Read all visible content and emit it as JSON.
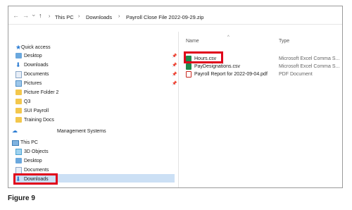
{
  "address_bar": {
    "back": "←",
    "forward": "→",
    "recent": "⌄",
    "up": "↑",
    "crumbs": [
      "This PC",
      "Downloads",
      "Payroll Close File 2022-09-29.zip"
    ]
  },
  "sidebar": {
    "quick_access": "Quick access",
    "items": [
      {
        "label": "Desktop"
      },
      {
        "label": "Downloads"
      },
      {
        "label": "Documents"
      },
      {
        "label": "Pictures"
      },
      {
        "label": "Picture Folder 2"
      },
      {
        "label": "Q3"
      },
      {
        "label": "SUI Payroll"
      },
      {
        "label": "Training Docs"
      }
    ],
    "management": "Management Systems",
    "this_pc": "This PC",
    "pc_items": [
      {
        "label": "3D Objects"
      },
      {
        "label": "Desktop"
      },
      {
        "label": "Documents"
      },
      {
        "label": "Downloads"
      }
    ]
  },
  "file_list": {
    "headers": {
      "name": "Name",
      "type": "Type"
    },
    "rows": [
      {
        "name": "Hours.csv",
        "type": "Microsoft Excel Comma S..."
      },
      {
        "name": "PayDesignations.csv",
        "type": "Microsoft Excel Comma S..."
      },
      {
        "name": "Payroll Report for 2022-09-04.pdf",
        "type": "PDF Document"
      }
    ]
  },
  "caption": "Figure 9",
  "colors": {
    "highlight": "#e0001b",
    "selection": "#cce0f5",
    "folder": "#f3c74c"
  }
}
